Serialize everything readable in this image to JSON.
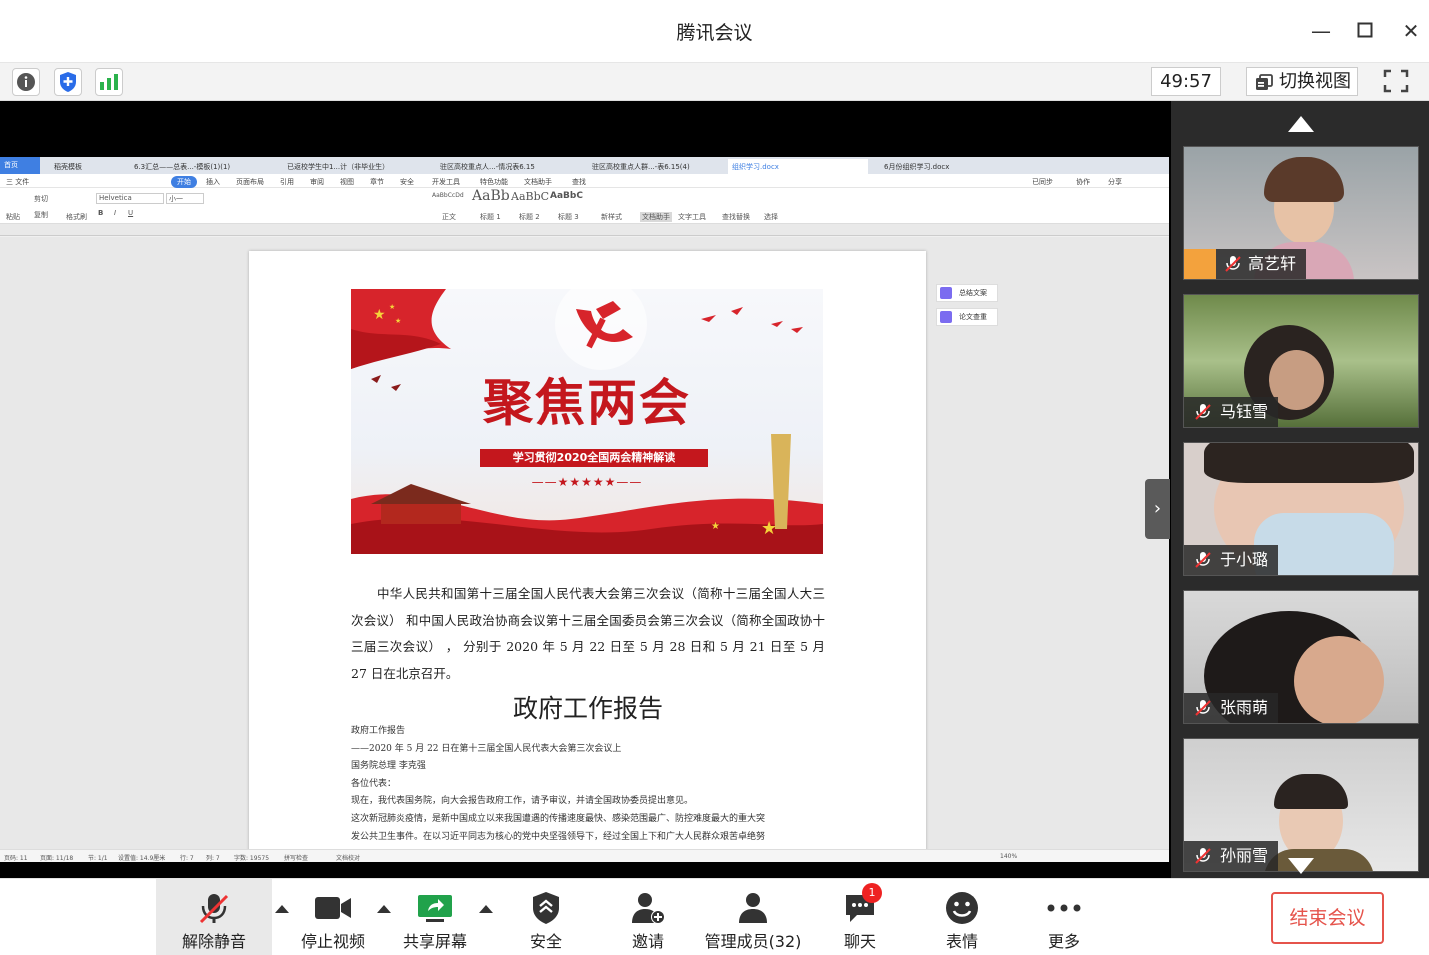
{
  "app": {
    "title": "腾讯会议"
  },
  "toolbar": {
    "timer": "49:57",
    "switch_view": "切换视图"
  },
  "doc": {
    "tabs": [
      "首页",
      "稻壳模板",
      "6.3汇总——总表...-模板(1)(1)",
      "已返校学生中1...计（非毕业生）",
      "驻区高校重点人...-情况表6.15",
      "驻区高校重点人群...-表6.15(4)",
      "组织学习.docx",
      "6月份组织学习.docx"
    ],
    "menu": [
      "三 文件",
      "开始",
      "插入",
      "页面布局",
      "引用",
      "审阅",
      "视图",
      "章节",
      "安全",
      "开发工具",
      "特色功能",
      "文档助手",
      "查找"
    ],
    "menu_right": [
      "已同步",
      "协作",
      "分享"
    ],
    "font_name": "Helvetica",
    "font_size": "小一",
    "styles": [
      "AaBbCcDd",
      "AaBb",
      "AaBbC",
      "AaBbC"
    ],
    "style_names": [
      "正文",
      "标题 1",
      "标题 2",
      "标题 3"
    ],
    "ribbon_left": [
      "粘贴",
      "剪切",
      "复制",
      "格式刷"
    ],
    "ribbon_right": [
      "新样式",
      "文档助手",
      "文字工具",
      "查找替换",
      "选择"
    ],
    "side_tools": [
      "总结文案",
      "论文查重"
    ],
    "banner": {
      "headline": "聚焦两会",
      "sub": "学习贯彻2020全国两会精神解读",
      "stars": "——★★★★★——"
    },
    "paragraph": "中华人民共和国第十三届全国人民代表大会第三次会议（简称十三届全国人大三次会议） 和中国人民政治协商会议第十三届全国委员会第三次会议（简称全国政协十三届三次会议） ， 分别于 2020 年 5 月 22 日至 5 月 28 日和 5 月 21 日至 5 月 27 日在北京召开。",
    "heading": "政府工作报告",
    "lines": [
      "政府工作报告",
      "——2020 年 5 月 22 日在第十三届全国人民代表大会第三次会议上",
      "国务院总理 李克强",
      "各位代表：",
      "现在，我代表国务院，向大会报告政府工作，请予审议，并请全国政协委员提出意见。",
      "这次新冠肺炎疫情，是新中国成立以来我国遭遇的传播速度最快、感染范围最广、防控难度最大的重大突",
      "发公共卫生事件。在以习近平同志为核心的党中央坚强领导下，经过全国上下和广大人民群众艰苦卓绝努"
    ],
    "status": {
      "page_num": "页码: 11",
      "pages": "页面: 11/18",
      "section": "节: 1/1",
      "setting": "设置值: 14.9厘米",
      "row": "行: 7",
      "col": "列: 7",
      "words": "字数: 19575",
      "spell": "拼写检查",
      "proof": "文档校对",
      "zoom": "140%"
    }
  },
  "participants": [
    {
      "name": "高艺轩"
    },
    {
      "name": "马钰雪"
    },
    {
      "name": "于小璐"
    },
    {
      "name": "张雨萌"
    },
    {
      "name": "孙丽雪"
    }
  ],
  "bottom": {
    "mute": "解除静音",
    "video": "停止视频",
    "share": "共享屏幕",
    "security": "安全",
    "invite": "邀请",
    "members": "管理成员(32)",
    "chat": "聊天",
    "chat_badge": "1",
    "emoji": "表情",
    "more": "更多",
    "end": "结束会议"
  },
  "colors": {
    "accent": "#3f7fe2",
    "party_red": "#c4171d",
    "end_red": "#e5534b"
  }
}
